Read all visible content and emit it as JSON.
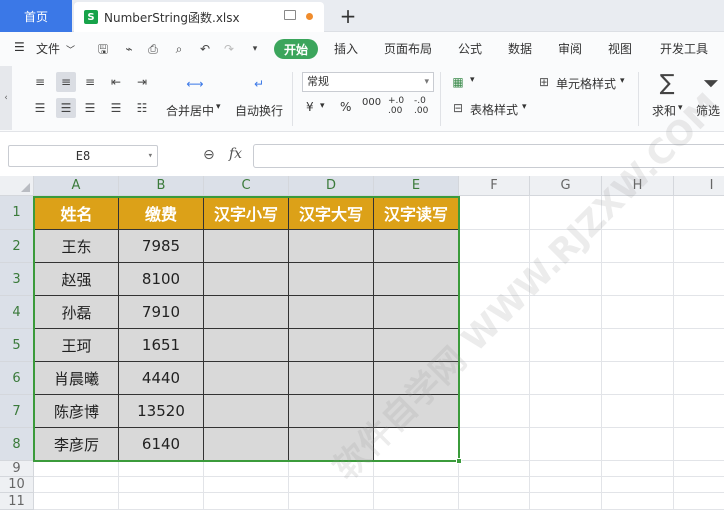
{
  "tabs": {
    "home": "首页",
    "file": "NumberString函数.xlsx",
    "file_icon": "S",
    "add": "+"
  },
  "menu": {
    "file": "文件",
    "items": [
      "开始",
      "插入",
      "页面布局",
      "公式",
      "数据",
      "审阅",
      "视图",
      "开发工具"
    ],
    "active_color": "#3ba55c"
  },
  "ribbon": {
    "merge_label": "合并居中",
    "wrap_label": "自动换行",
    "format_value": "常规",
    "currency_symbol": "¥",
    "percent_symbol": "%",
    "thousands_symbol": "000",
    "inc_decimal": "+.0\n.00",
    "dec_decimal": "-.0\n.00",
    "cell_style_label": "单元格样式",
    "table_style_label": "表格样式",
    "sum_label": "求和",
    "filter_label": "筛选",
    "sum_symbol": "∑"
  },
  "formula_bar": {
    "name_box": "E8",
    "fx": "fx",
    "formula": ""
  },
  "sheet": {
    "columns": [
      "A",
      "B",
      "C",
      "D",
      "E",
      "F",
      "G",
      "H",
      "I"
    ],
    "rows": [
      "1",
      "2",
      "3",
      "4",
      "5",
      "6",
      "7",
      "8",
      "9",
      "10",
      "11"
    ],
    "header": [
      "姓名",
      "缴费",
      "汉字小写",
      "汉字大写",
      "汉字读写"
    ],
    "data": [
      [
        "王东",
        "7985"
      ],
      [
        "赵强",
        "8100"
      ],
      [
        "孙磊",
        "7910"
      ],
      [
        "王珂",
        "1651"
      ],
      [
        "肖晨曦",
        "4440"
      ],
      [
        "陈彦博",
        "13520"
      ],
      [
        "李彦厉",
        "6140"
      ]
    ],
    "header_color": "#dca118",
    "fill_color": "#d9d9d9",
    "selection_color": "#3b9b3b"
  },
  "watermark": "软件自学网 WWW.RJZXW.COM"
}
